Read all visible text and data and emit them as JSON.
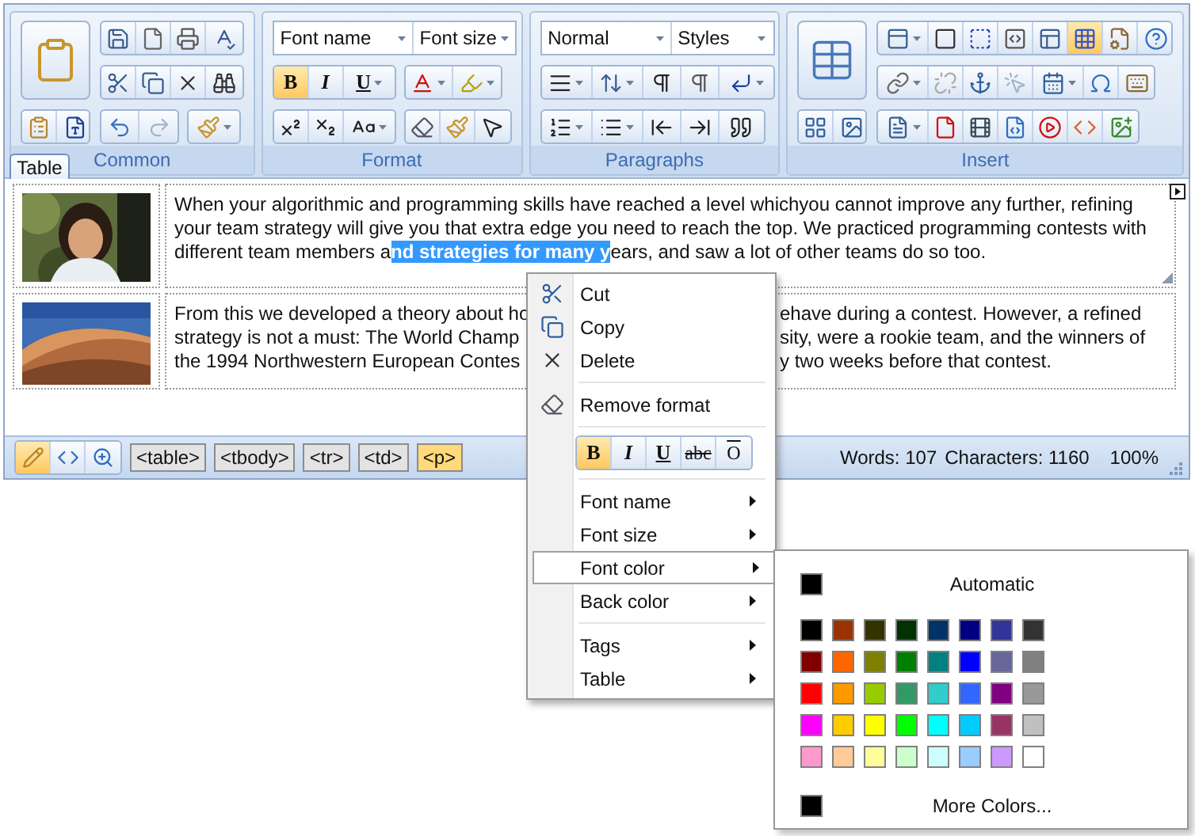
{
  "ribbon": {
    "tabs": [
      {
        "label": "Table",
        "selected": true
      }
    ],
    "groups": [
      {
        "kind": "common",
        "label": "Common"
      },
      {
        "kind": "format",
        "label": "Format",
        "font_name": "Font name",
        "font_size": "Font size",
        "style_buttons": [
          {
            "label": "B",
            "active": true
          },
          {
            "label": "I",
            "active": false
          },
          {
            "label": "U",
            "active": false
          }
        ]
      },
      {
        "kind": "paragraphs",
        "label": "Paragraphs",
        "format_block": "Normal",
        "styles": "Styles"
      },
      {
        "kind": "insert",
        "label": "Insert",
        "grid_toggle": {
          "active": true
        }
      }
    ]
  },
  "document": {
    "rows": [
      {
        "text": {
          "kind": "selection",
          "before": "When your algorithmic and programming skills have reached a level whichyou cannot improve any further, refining your team strategy will give you that extra edge you need to reach the top. We practiced programming contests with different team members a",
          "selected": "nd strategies for many y",
          "after": "ears, and saw a lot of other teams do so too."
        }
      },
      {
        "text": {
          "kind": "covered",
          "lines": [
            {
              "left": "From this we developed a theory about ho",
              "right": "ehave during a contest. However, a refined"
            },
            {
              "left": "strategy is not a must: The World Champ",
              "right": "sity, were a rookie team, and the winners of"
            },
            {
              "left": "the 1994 Northwestern European Contes",
              "right": "y two weeks before that contest."
            }
          ]
        }
      }
    ]
  },
  "status_bar": {
    "modes": [
      {
        "selected": true
      },
      {
        "selected": false
      },
      {
        "selected": false
      }
    ],
    "tags": [
      {
        "label": "<table>",
        "selected": false
      },
      {
        "label": "<tbody>",
        "selected": false
      },
      {
        "label": "<tr>",
        "selected": false
      },
      {
        "label": "<td>",
        "selected": false
      },
      {
        "label": "<p>",
        "selected": true
      }
    ],
    "words": "Words: 107",
    "characters": "Characters: 1160",
    "zoom": "100%"
  },
  "context_menu": {
    "items": [
      {
        "kind": "command",
        "label": "Cut"
      },
      {
        "kind": "command",
        "label": "Copy"
      },
      {
        "kind": "command",
        "label": "Delete"
      },
      {
        "kind": "separator"
      },
      {
        "kind": "command",
        "label": "Remove format"
      },
      {
        "kind": "separator"
      },
      {
        "kind": "format_bar",
        "buttons": [
          {
            "label": "B",
            "active": true
          },
          {
            "label": "I",
            "active": false
          },
          {
            "label": "U",
            "active": false
          },
          {
            "label": "abc",
            "active": false
          },
          {
            "label": "O",
            "active": false
          }
        ]
      },
      {
        "kind": "separator"
      },
      {
        "kind": "submenu",
        "label": "Font name",
        "selected": false
      },
      {
        "kind": "submenu",
        "label": "Font size",
        "selected": false
      },
      {
        "kind": "submenu",
        "label": "Font color",
        "selected": true
      },
      {
        "kind": "submenu",
        "label": "Back color",
        "selected": false
      },
      {
        "kind": "separator"
      },
      {
        "kind": "submenu",
        "label": "Tags",
        "selected": false
      },
      {
        "kind": "submenu",
        "label": "Table",
        "selected": false
      }
    ]
  },
  "color_menu": {
    "automatic": {
      "label": "Automatic",
      "color": "#000000"
    },
    "swatches": [
      [
        {
          "color": "#000000"
        },
        {
          "color": "#993300"
        },
        {
          "color": "#333300"
        },
        {
          "color": "#003300"
        },
        {
          "color": "#003366"
        },
        {
          "color": "#000080"
        },
        {
          "color": "#333399"
        },
        {
          "color": "#333333"
        }
      ],
      [
        {
          "color": "#800000"
        },
        {
          "color": "#ff6600"
        },
        {
          "color": "#808000"
        },
        {
          "color": "#008000"
        },
        {
          "color": "#008080"
        },
        {
          "color": "#0000ff"
        },
        {
          "color": "#666699"
        },
        {
          "color": "#808080"
        }
      ],
      [
        {
          "color": "#ff0000"
        },
        {
          "color": "#ff9900"
        },
        {
          "color": "#99cc00"
        },
        {
          "color": "#339966"
        },
        {
          "color": "#33cccc"
        },
        {
          "color": "#3366ff"
        },
        {
          "color": "#800080"
        },
        {
          "color": "#999999"
        }
      ],
      [
        {
          "color": "#ff00ff"
        },
        {
          "color": "#ffcc00"
        },
        {
          "color": "#ffff00"
        },
        {
          "color": "#00ff00"
        },
        {
          "color": "#00ffff"
        },
        {
          "color": "#00ccff"
        },
        {
          "color": "#993366"
        },
        {
          "color": "#c0c0c0"
        }
      ],
      [
        {
          "color": "#ff99cc"
        },
        {
          "color": "#ffcc99"
        },
        {
          "color": "#ffff99"
        },
        {
          "color": "#ccffcc"
        },
        {
          "color": "#ccffff"
        },
        {
          "color": "#99ccff"
        },
        {
          "color": "#cc99ff"
        },
        {
          "color": "#ffffff"
        }
      ]
    ],
    "more": {
      "label": "More Colors...",
      "color": "#000000"
    }
  }
}
